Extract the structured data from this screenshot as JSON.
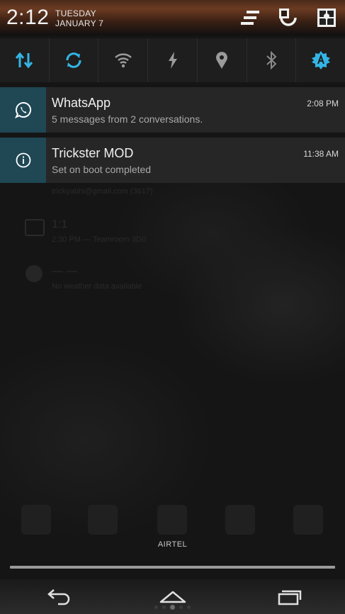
{
  "status_header": {
    "time": "2:12",
    "day": "TUESDAY",
    "date": "JANUARY 7"
  },
  "quick_settings": [
    {
      "name": "mobile-data",
      "icon": "data-arrows-icon",
      "active": true
    },
    {
      "name": "sync",
      "icon": "sync-icon",
      "active": true
    },
    {
      "name": "wifi",
      "icon": "wifi-icon",
      "active": false
    },
    {
      "name": "flash",
      "icon": "lightning-icon",
      "active": false
    },
    {
      "name": "location",
      "icon": "location-pin-icon",
      "active": false
    },
    {
      "name": "bluetooth",
      "icon": "bluetooth-icon",
      "active": false
    },
    {
      "name": "auto-brightness",
      "icon": "auto-brightness-icon",
      "active": true
    }
  ],
  "notifications": [
    {
      "app": "WhatsApp",
      "text": "5 messages from 2 conversations.",
      "time": "2:08 PM",
      "icon": "whatsapp-icon"
    },
    {
      "app": "Trickster MOD",
      "text": "Set on boot completed",
      "time": "11:38 AM",
      "icon": "info-icon"
    }
  ],
  "background_ghost": {
    "email": "trickyabhi@gmail.com (3617)",
    "calendar_title": "1:1",
    "calendar_sub": "2:30 PM — Teamroom 3D0",
    "weather_title": "— —",
    "weather_sub": "No weather data available"
  },
  "carrier": "AIRTEL",
  "colors": {
    "accent": "#33b5e5",
    "notification_icon_bg": "#1f4754",
    "notification_bg": "#262626"
  },
  "nav": {
    "back": "back-icon",
    "home": "home-icon",
    "recents": "recents-icon"
  }
}
